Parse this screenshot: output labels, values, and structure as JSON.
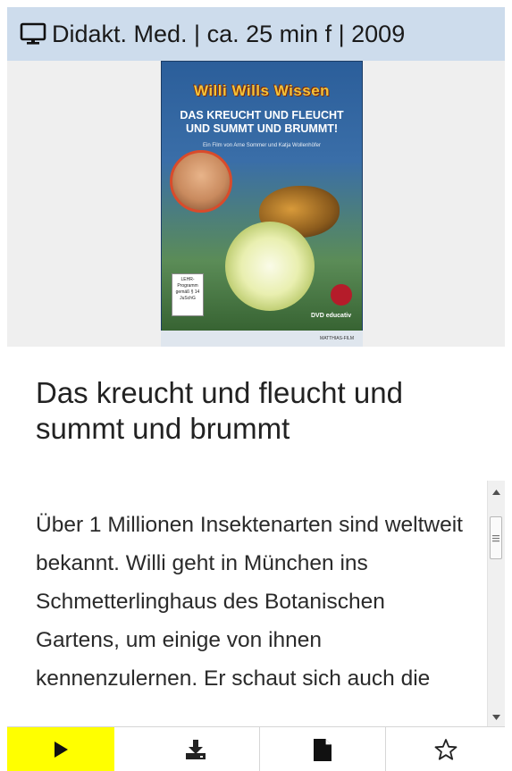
{
  "meta": {
    "icon": "monitor-icon",
    "text": "Didakt. Med. | ca. 25 min f | 2009"
  },
  "cover": {
    "brand": "Willi Wills Wissen",
    "headline": "Das kreucht und fleucht und summt und brummt!",
    "credit": "Ein Film von Arne Sommer und Katja Wollenhöfer",
    "rating": "LEHR-Programm gemäß § 14 JuSchG",
    "dvd": "DVD educativ",
    "publisher": "MATTHIAS-FILM"
  },
  "title": "Das kreucht und fleucht und summt und brummt",
  "description": "Über 1 Millionen Insektenarten sind weltweit bekannt. Willi geht in München ins Schmetterlinghaus des Botanischen Gartens, um einige von ihnen kennenzulernen. Er schaut sich auch die",
  "toolbar": {
    "play_icon": "play-icon",
    "download_icon": "download-icon",
    "document_icon": "document-icon",
    "star_icon": "star-icon",
    "play_highlight": "#ffff00"
  },
  "colors": {
    "meta_bar": "#cddcec",
    "cover_bg": "#efefef"
  }
}
